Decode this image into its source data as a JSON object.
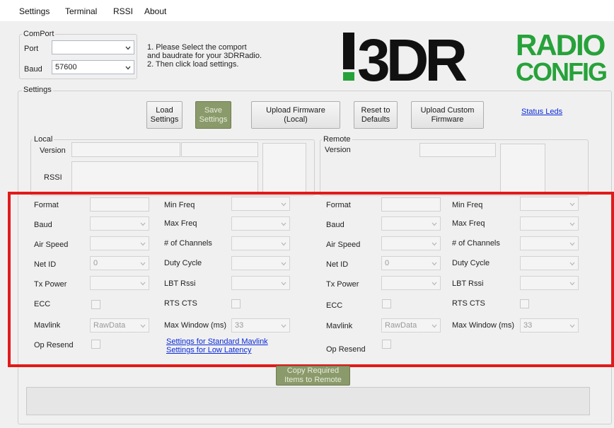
{
  "menu": [
    "Settings",
    "Terminal",
    "RSSI",
    "About"
  ],
  "comport": {
    "group_title": "ComPort",
    "port_label": "Port",
    "port_value": "",
    "baud_label": "Baud",
    "baud_value": "57600"
  },
  "instructions": "1. Please Select the comport\n    and baudrate for your 3DRRadio.\n2. Then click load settings.",
  "logo": {
    "big_text": "3DR",
    "top_right": "RADIO",
    "bottom_right": "CONFIG",
    "colors": {
      "black": "#111111",
      "green": "#27a23a"
    }
  },
  "settings_group_title": "Settings",
  "buttons": {
    "load": "Load\nSettings",
    "save": "Save\nSettings",
    "upload_local": "Upload Firmware\n(Local)",
    "reset": "Reset to\nDefaults",
    "upload_custom": "Upload Custom\nFirmware",
    "copy": "Copy Required\nItems to Remote"
  },
  "status_leds_link": "Status Leds",
  "local": {
    "title": "Local",
    "version_label": "Version",
    "rssi_label": "RSSI"
  },
  "remote": {
    "title": "Remote",
    "version_label": "Version"
  },
  "params_left": {
    "format": "Format",
    "baud": "Baud",
    "air_speed": "Air Speed",
    "net_id": "Net ID",
    "net_id_value": "0",
    "tx_power": "Tx Power",
    "ecc": "ECC",
    "mavlink": "Mavlink",
    "mavlink_value": "RawData",
    "op_resend": "Op Resend"
  },
  "params_left_col2": {
    "min_freq": "Min Freq",
    "max_freq": "Max Freq",
    "channels": "# of Channels",
    "duty_cycle": "Duty Cycle",
    "lbt_rssi": "LBT Rssi",
    "rts_cts": "RTS CTS",
    "max_window": "Max Window (ms)",
    "max_window_value": "33"
  },
  "links": {
    "standard_mavlink": "Settings for Standard Mavlink",
    "low_latency": "Settings for Low Latency"
  },
  "params_right": {
    "format": "Format",
    "baud": "Baud",
    "air_speed": "Air Speed",
    "net_id": "Net ID",
    "net_id_value": "0",
    "tx_power": "Tx Power",
    "ecc": "ECC",
    "mavlink": "Mavlink",
    "mavlink_value": "RawData",
    "op_resend": "Op Resend"
  },
  "params_right_col2": {
    "min_freq": "Min Freq",
    "max_freq": "Max Freq",
    "channels": "# of Channels",
    "duty_cycle": "Duty Cycle",
    "lbt_rssi": "LBT Rssi",
    "rts_cts": "RTS CTS",
    "max_window": "Max Window (ms)",
    "max_window_value": "33"
  },
  "highlight_color": "#e21a1a"
}
